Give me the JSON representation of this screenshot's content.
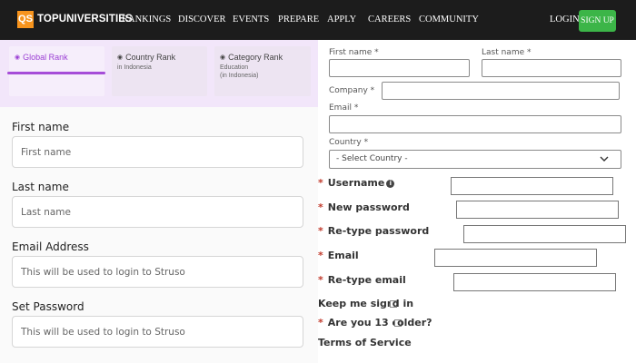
{
  "nav": {
    "logo_mark": "QS",
    "logo_text": "TOPUNIVERSITIES",
    "items": [
      "RANKINGS",
      "DISCOVER",
      "EVENTS",
      "PREPARE",
      "APPLY",
      "CAREERS",
      "COMMUNITY"
    ],
    "login": "LOGIN",
    "signup": "SIGN UP"
  },
  "rank_tabs": [
    {
      "title": "Global Rank",
      "sub": ""
    },
    {
      "title": "Country Rank",
      "sub": "in Indonesia"
    },
    {
      "title": "Category Rank",
      "sub": "Education\n(in Indonesia)"
    }
  ],
  "left_form": {
    "first_name_label": "First name",
    "first_name_placeholder": "First name",
    "last_name_label": "Last name",
    "last_name_placeholder": "Last name",
    "email_label": "Email Address",
    "email_placeholder": "This will be used to login to Struso",
    "password_label": "Set Password",
    "password_placeholder": "This will be used to login to Struso"
  },
  "right_form": {
    "first_name_label": "First name *",
    "last_name_label": "Last name *",
    "company_label": "Company *",
    "email_label": "Email *",
    "country_label": "Country *",
    "country_value": "- Select Country -"
  },
  "signup_form": {
    "username_label": "Username",
    "new_password_label": "New password",
    "retype_password_label": "Re-type password",
    "email_label": "Email",
    "retype_email_label": "Re-type email",
    "keep_signed_a": "Keep me sign",
    "keep_signed_b": "d in",
    "age_a": "Are you 13 o",
    "age_b": "older?",
    "terms": "Terms of Service",
    "required_mark": "*",
    "info_mark": "i"
  }
}
